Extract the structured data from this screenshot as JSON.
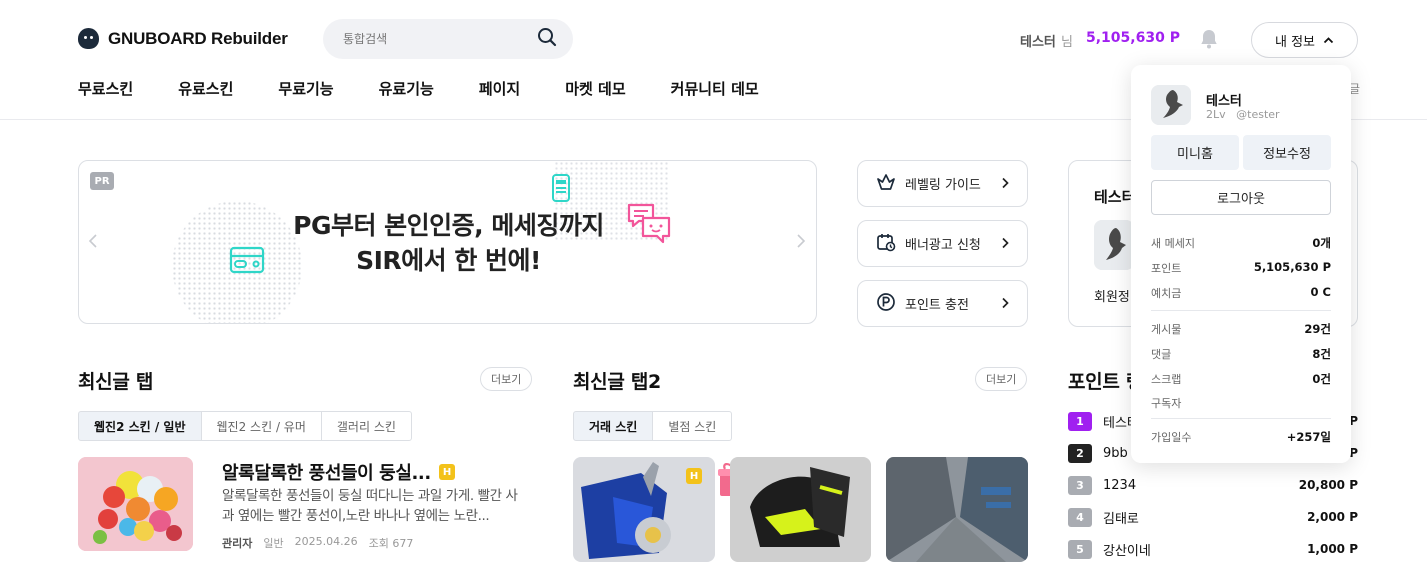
{
  "header": {
    "logo_text": "GNUBOARD Rebuilder",
    "search_placeholder": "통합검색",
    "user_name": "테스터",
    "user_suffix": "님",
    "user_point": "5,105,630 P",
    "myinfo_label": "내 정보",
    "right_fragment": "글"
  },
  "nav": {
    "items": [
      "무료스킨",
      "유료스킨",
      "무료기능",
      "유료기능",
      "페이지",
      "마켓 데모",
      "커뮤니티 데모"
    ]
  },
  "banner": {
    "badge": "PR",
    "headline_line1": "PG부터 본인인증, 메세징까지",
    "headline_line2": "SIR에서 한 번에!"
  },
  "quick_links": [
    {
      "label": "레벨링 가이드",
      "icon": "basket-icon"
    },
    {
      "label": "배너광고 신청",
      "icon": "calendar-icon"
    },
    {
      "label": "포인트 충전",
      "icon": "point-icon"
    }
  ],
  "member_box": {
    "title_fragment": "테스터",
    "footer_fragment": "회원정"
  },
  "latest1": {
    "title": "최신글 탭",
    "more": "더보기",
    "tabs": [
      "웹진2 스킨 / 일반",
      "웹진2 스킨 / 유머",
      "갤러리 스킨"
    ],
    "post": {
      "title": "알록달록한 풍선들이 둥실...",
      "badge": "H",
      "desc": "알록달록한 풍선들이 둥실 떠다니는 과일 가게. 빨간 사과 옆에는 빨간 풍선이,노란 바나나 옆에는 노란...",
      "author": "관리자",
      "category": "일반",
      "date": "2025.04.26",
      "views": "조회 677"
    }
  },
  "latest2": {
    "title": "최신글 탭2",
    "more": "더보기",
    "tabs": [
      "거래 스킨",
      "별점 스킨"
    ],
    "badge": "H"
  },
  "ranking": {
    "title_fragment": "포인트 랭",
    "rows": [
      {
        "rank": "1",
        "name": "테스터",
        "point": "P",
        "color": "#a020f0"
      },
      {
        "rank": "2",
        "name": "9bb",
        "point": "P",
        "color": "#222222"
      },
      {
        "rank": "3",
        "name": "1234",
        "point": "20,800 P",
        "color": "#a9acb2"
      },
      {
        "rank": "4",
        "name": "김태로",
        "point": "2,000 P",
        "color": "#a9acb2"
      },
      {
        "rank": "5",
        "name": "강산이네",
        "point": "1,000 P",
        "color": "#a9acb2"
      }
    ]
  },
  "dropdown": {
    "name": "테스터",
    "level": "2Lv",
    "handle": "@tester",
    "btn_minihome": "미니홈",
    "btn_edit": "정보수정",
    "btn_logout": "로그아웃",
    "stats1": [
      {
        "label": "새 메세지",
        "value": "0개"
      },
      {
        "label": "포인트",
        "value": "5,105,630 P"
      },
      {
        "label": "예치금",
        "value": "0 C"
      }
    ],
    "stats2": [
      {
        "label": "게시물",
        "value": "29건"
      },
      {
        "label": "댓글",
        "value": "8건"
      },
      {
        "label": "스크랩",
        "value": "0건"
      },
      {
        "label": "구독자",
        "value": ""
      }
    ],
    "stats3": [
      {
        "label": "가입일수",
        "value": "+257일"
      }
    ]
  },
  "colors": {
    "accent_purple": "#a020f0",
    "tab_active_bg": "#eef2f7",
    "border": "#dcdfe4",
    "badge_yellow": "#f3c21a"
  }
}
